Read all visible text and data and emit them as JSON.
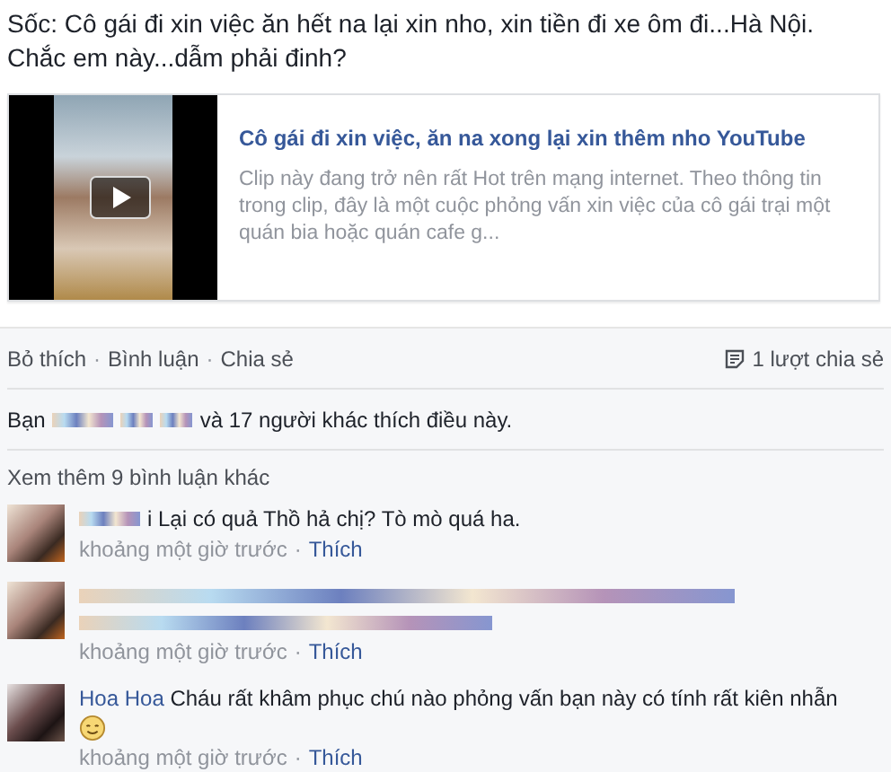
{
  "post": {
    "text": "Sốc: Cô gái đi xin việc ăn hết na lại xin nho, xin tiền đi xe ôm đi...Hà Nội. Chắc em này...dẫm phải đinh?",
    "link": {
      "title": "Cô gái đi xin việc, ăn na xong lại xin thêm nho YouTube",
      "description": "Clip này đang trở nên rất Hot trên mạng internet. Theo thông tin trong clip, đây là một cuộc phỏng vấn xin việc của cô gái trại một quán bia hoặc quán cafe g..."
    }
  },
  "actions": [
    "Bỏ thích",
    "Bình luận",
    "Chia sẻ"
  ],
  "separator": "·",
  "shares": "1 lượt chia sẻ",
  "likes": {
    "prefix": "Bạn",
    "suffix": "và 17 người khác thích điều này."
  },
  "more_comments": "Xem thêm 9 bình luận khác",
  "comments": [
    {
      "kind": "redacted_author",
      "text": "i Lại có quả Thồ hả chị? Tò mò quá ha.",
      "time": "khoảng một giờ trước",
      "like": "Thích"
    },
    {
      "kind": "redacted_body",
      "time": "khoảng một giờ trước",
      "like": "Thích"
    },
    {
      "kind": "named",
      "author": "Hoa Hoa",
      "text": "Cháu rất khâm phục chú nào phỏng vấn bạn này có tính rất kiên nhẫn",
      "emoji": true,
      "time": "khoảng một giờ trước",
      "like": "Thích"
    }
  ]
}
